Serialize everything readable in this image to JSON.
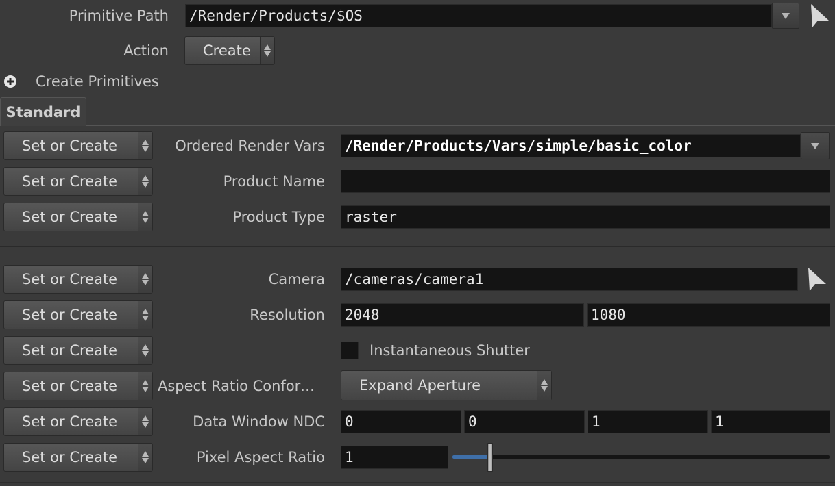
{
  "header": {
    "primitive_path_label": "Primitive Path",
    "primitive_path_value": "/Render/Products/$OS",
    "action_label": "Action",
    "action_value": "Create",
    "create_primitives_label": "Create Primitives"
  },
  "tabs": [
    {
      "label": "Standard",
      "active": true
    }
  ],
  "set_or_create_label": "Set or Create",
  "params": {
    "ordered_render_vars": {
      "label": "Ordered Render Vars",
      "value": "/Render/Products/Vars/simple/basic_color"
    },
    "product_name": {
      "label": "Product Name",
      "value": ""
    },
    "product_type": {
      "label": "Product Type",
      "value": "raster"
    },
    "camera": {
      "label": "Camera",
      "value": "/cameras/camera1"
    },
    "resolution": {
      "label": "Resolution",
      "values": [
        "2048",
        "1080"
      ]
    },
    "instantaneous_shutter": {
      "label": "Instantaneous Shutter",
      "checked": false
    },
    "aspect_ratio": {
      "label": "Aspect Ratio Conform…",
      "value": "Expand Aperture"
    },
    "data_window_ndc": {
      "label": "Data Window NDC",
      "values": [
        "0",
        "0",
        "1",
        "1"
      ]
    },
    "pixel_aspect_ratio": {
      "label": "Pixel Aspect Ratio",
      "value": "1",
      "slider_fraction": 0.1
    }
  },
  "colors": {
    "background": "#3a3a3a",
    "field": "#141414",
    "slider_fill": "#3f6fa8"
  },
  "icons": [
    "chevron-down-icon",
    "pointer-arrow-icon",
    "plus-circle-icon",
    "updown-arrows-icon"
  ]
}
